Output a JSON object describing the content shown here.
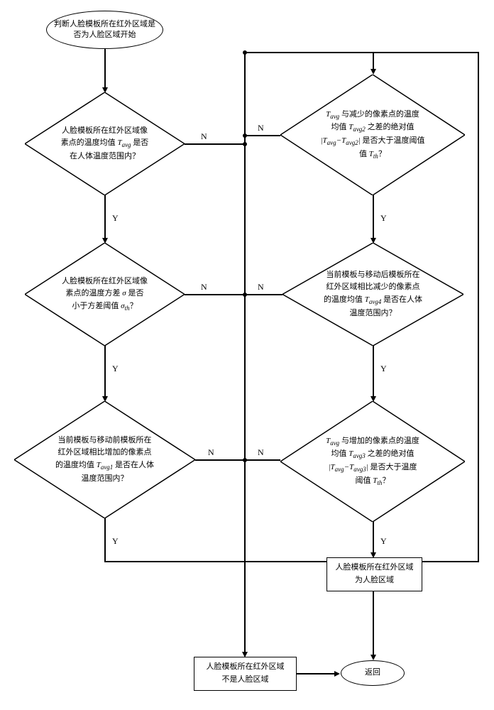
{
  "start": "判断人脸模板所在红外区域是否为人脸区域开始",
  "d1_l1": "人脸模板所在红外区域像",
  "d1_l2": "素点的温度均值",
  "d1_l3": "是否",
  "d1_l4": "在人体温度范围内？",
  "d2_l1": "人脸模板所在红外区域像",
  "d2_l2": "素点的温度方差",
  "d2_l3": "是否",
  "d2_l4": "小于方差阈值",
  "d2_l5": "？",
  "d3_l1": "当前模板与移动前模板所在",
  "d3_l2": "红外区域相比增加的像素点",
  "d3_l3": "的温度均值",
  "d3_l4": "是否在人体",
  "d3_l5": "温度范围内？",
  "d4_l1": "与减少的像素点的温度",
  "d4_l2": "均值",
  "d4_l3": "之差的绝对值",
  "d4_l4": "是否大于温度阈值",
  "d4_l5": "？",
  "d5_l1": "当前模板与移动后模板所在",
  "d5_l2": "红外区域相比减少的像素点",
  "d5_l3": "的温度均值",
  "d5_l4": "是否在人体",
  "d5_l5": "温度范围内？",
  "d6_l1": "与增加的像素点的温度",
  "d6_l2": "均值",
  "d6_l3": "之差的绝对值",
  "d6_l4": "是否大于温度",
  "d6_l5": "阈值",
  "d6_l6": "？",
  "box_yes_l1": "人脸模板所在红外区域",
  "box_yes_l2": "为人脸区域",
  "box_no_l1": "人脸模板所在红外区域",
  "box_no_l2": "不是人脸区域",
  "return": "返回",
  "Y": "Y",
  "N": "N",
  "Tavg": "T",
  "sub_avg": "avg",
  "sub_avg1": "avg1",
  "sub_avg2": "avg2",
  "sub_avg3": "avg3",
  "sub_avg4": "avg4",
  "sub_th": "th",
  "sigma": "σ"
}
